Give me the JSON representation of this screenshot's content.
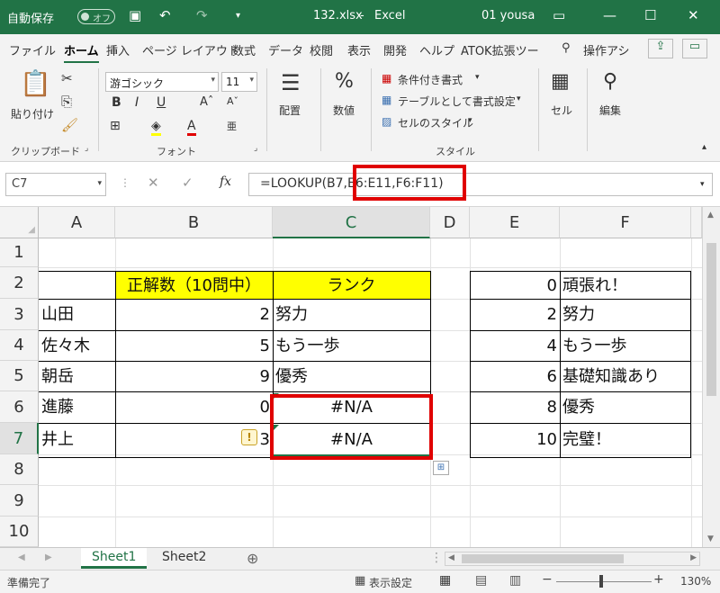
{
  "titlebar": {
    "autosave_label": "自動保存",
    "autosave_state": "オフ",
    "filename": "132.xlsx",
    "separator": "-",
    "app": "Excel",
    "user": "01 yousa"
  },
  "tabs": [
    "ファイル",
    "ホーム",
    "挿入",
    "ページ レイアウト",
    "数式",
    "データ",
    "校閲",
    "表示",
    "開発",
    "ヘルプ",
    "ATOK拡張ツー"
  ],
  "tab_search": "操作アシ",
  "ribbon": {
    "clipboard": {
      "paste": "貼り付け",
      "label": "クリップボード"
    },
    "font": {
      "name": "游ゴシック",
      "size": "11",
      "label": "フォント",
      "bold": "B",
      "italic": "I",
      "underline": "U",
      "font_color": "A"
    },
    "alignment": {
      "label": "配置"
    },
    "number": {
      "label": "数値",
      "symbol": "%"
    },
    "styles": {
      "conditional": "条件付き書式",
      "table": "テーブルとして書式設定",
      "cell": "セルのスタイル",
      "label": "スタイル"
    },
    "cells": {
      "label": "セル"
    },
    "editing": {
      "label": "編集"
    }
  },
  "formula_bar": {
    "name_box": "C7",
    "fx": "fx",
    "formula": "=LOOKUP(B7,E6:E11,F6:F11)"
  },
  "grid": {
    "columns": [
      "A",
      "B",
      "C",
      "D",
      "E",
      "F"
    ],
    "rows": [
      "1",
      "2",
      "3",
      "4",
      "5",
      "6",
      "7",
      "8",
      "9",
      "10"
    ],
    "header_b": "正解数（10問中）",
    "header_c": "ランク",
    "names": [
      "山田",
      "佐々木",
      "朝岳",
      "進藤",
      "井上"
    ],
    "scores": [
      "2",
      "5",
      "9",
      "0",
      "3"
    ],
    "ranks": [
      "努力",
      "もう一歩",
      "優秀",
      "#N/A",
      "#N/A"
    ],
    "lookup_e": [
      "0",
      "2",
      "4",
      "6",
      "8",
      "10"
    ],
    "lookup_f": [
      "頑張れ！",
      "努力",
      "もう一歩",
      "基礎知識あり",
      "優秀",
      "完璧！"
    ]
  },
  "sheets": [
    "Sheet1",
    "Sheet2"
  ],
  "status": {
    "ready": "準備完了",
    "display_settings": "表示設定",
    "zoom": "130%"
  },
  "colors": {
    "excel_green": "#217346",
    "highlight_yellow": "#ffff00",
    "annotation_red": "#e00000"
  }
}
